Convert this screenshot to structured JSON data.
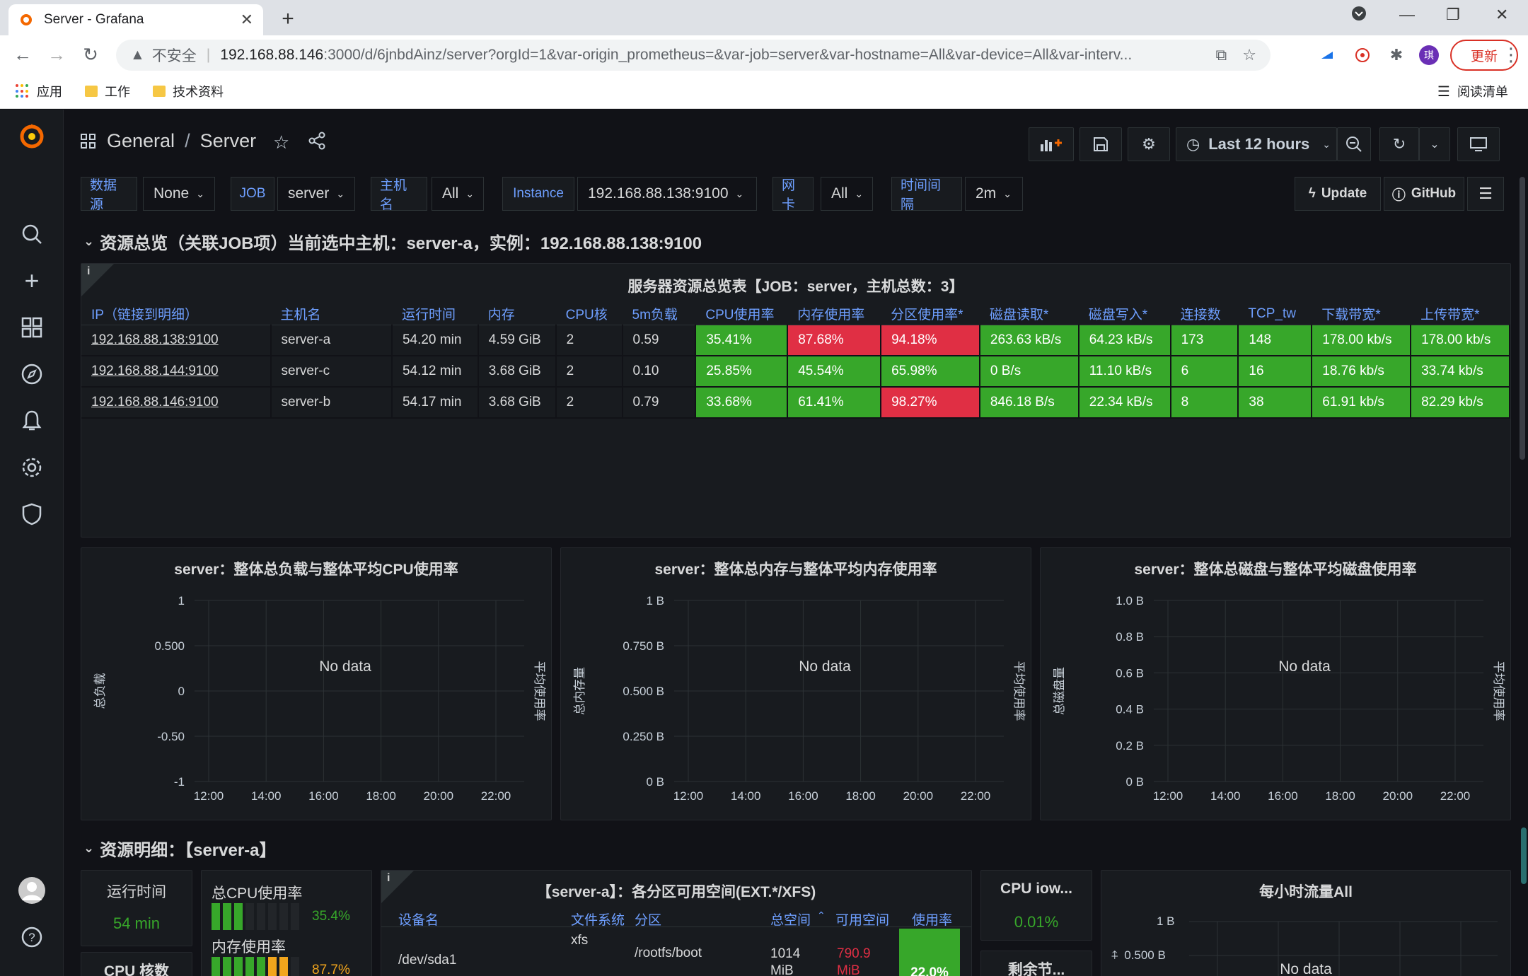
{
  "browser": {
    "tab_title": "Server - Grafana",
    "insecure_label": "不安全",
    "url_host": "192.168.88.146",
    "url_rest": ":3000/d/6jnbdAinz/server?orgId=1&var-origin_prometheus=&var-job=server&var-hostname=All&var-device=All&var-interv...",
    "update_label": "更新",
    "profile_initial": "琪",
    "bookmarks": [
      "应用",
      "工作",
      "技术资料"
    ],
    "reading_list": "阅读清单"
  },
  "dashboard": {
    "folder": "General",
    "title": "Server",
    "time_range": "Last 12 hours"
  },
  "variables": [
    {
      "label": "数据源",
      "value": "None"
    },
    {
      "label": "JOB",
      "value": "server"
    },
    {
      "label": "主机名",
      "value": "All"
    },
    {
      "label": "Instance",
      "value": "192.168.88.138:9100"
    },
    {
      "label": "网卡",
      "value": "All"
    },
    {
      "label": "时间间隔",
      "value": "2m"
    }
  ],
  "links": {
    "update": "Update",
    "github": "GitHub"
  },
  "row1_title": "资源总览（关联JOB项）当前选中主机：server-a，实例：192.168.88.138:9100",
  "overview_table": {
    "title": "服务器资源总览表【JOB：server，主机总数：3】",
    "info_icon": "i",
    "columns": [
      "IP（链接到明细）",
      "主机名",
      "运行时间",
      "内存",
      "CPU核",
      "5m负载",
      "CPU使用率",
      "内存使用率",
      "分区使用率*",
      "磁盘读取*",
      "磁盘写入*",
      "连接数",
      "TCP_tw",
      "下载带宽*",
      "上传带宽*"
    ],
    "rows": [
      {
        "cells": [
          "192.168.88.138:9100",
          "server-a",
          "54.20 min",
          "4.59 GiB",
          "2",
          "0.59",
          "35.41%",
          "87.68%",
          "94.18%",
          "263.63 kB/s",
          "64.23 kB/s",
          "173",
          "148",
          "178.00 kb/s",
          "178.00 kb/s"
        ],
        "status": [
          "",
          "",
          "",
          "",
          "",
          "",
          "g",
          "r",
          "r",
          "g",
          "g",
          "g",
          "g",
          "g",
          "g"
        ]
      },
      {
        "cells": [
          "192.168.88.144:9100",
          "server-c",
          "54.12 min",
          "3.68 GiB",
          "2",
          "0.10",
          "25.85%",
          "45.54%",
          "65.98%",
          "0 B/s",
          "11.10 kB/s",
          "6",
          "16",
          "18.76 kb/s",
          "33.74 kb/s"
        ],
        "status": [
          "",
          "",
          "",
          "",
          "",
          "",
          "g",
          "g",
          "g",
          "g",
          "g",
          "g",
          "g",
          "g",
          "g"
        ]
      },
      {
        "cells": [
          "192.168.88.146:9100",
          "server-b",
          "54.17 min",
          "3.68 GiB",
          "2",
          "0.79",
          "33.68%",
          "61.41%",
          "98.27%",
          "846.18 B/s",
          "22.34 kB/s",
          "8",
          "38",
          "61.91 kb/s",
          "82.29 kb/s"
        ],
        "status": [
          "",
          "",
          "",
          "",
          "",
          "",
          "g",
          "g",
          "r",
          "g",
          "g",
          "g",
          "g",
          "g",
          "g"
        ]
      }
    ]
  },
  "chart_data": [
    {
      "type": "line",
      "title": "server：整体总负载与整体平均CPU使用率",
      "ylabel": "总负载",
      "y2label": "平均使用率",
      "yticks": [
        "1",
        "0.500",
        "0",
        "-0.50",
        "-1"
      ],
      "xticks": [
        "12:00",
        "14:00",
        "16:00",
        "18:00",
        "20:00",
        "22:00"
      ],
      "ylim": [
        -1,
        1
      ],
      "series": [],
      "no_data": "No data"
    },
    {
      "type": "line",
      "title": "server：整体总内存与整体平均内存使用率",
      "ylabel": "总内存量",
      "y2label": "平均使用率",
      "yticks": [
        "1 B",
        "0.750 B",
        "0.500 B",
        "0.250 B",
        "0 B"
      ],
      "xticks": [
        "12:00",
        "14:00",
        "16:00",
        "18:00",
        "20:00",
        "22:00"
      ],
      "ylim": [
        0,
        1
      ],
      "series": [],
      "no_data": "No data"
    },
    {
      "type": "line",
      "title": "server：整体总磁盘与整体平均磁盘使用率",
      "ylabel": "总磁盘量",
      "y2label": "平均使用率",
      "yticks": [
        "1.0 B",
        "0.8 B",
        "0.6 B",
        "0.4 B",
        "0.2 B",
        "0 B"
      ],
      "xticks": [
        "12:00",
        "14:00",
        "16:00",
        "18:00",
        "20:00",
        "22:00"
      ],
      "ylim": [
        0,
        1
      ],
      "series": [],
      "no_data": "No data"
    }
  ],
  "row2_title": "资源明细：【server-a】",
  "stats": {
    "uptime_title": "运行时间",
    "uptime_value": "54 min",
    "cpu_cores_title": "CPU 核数",
    "cpu_usage_title": "总CPU使用率",
    "cpu_usage_value": "35.4%",
    "cpu_usage_fraction": 0.354,
    "mem_usage_title": "内存使用率",
    "mem_usage_value": "87.7%",
    "mem_usage_fraction": 0.877,
    "iowait_title": "CPU iow...",
    "iowait_value": "0.01%",
    "remaining_title": "剩余节..."
  },
  "partition_table": {
    "title": "【server-a】：各分区可用空间(EXT.*/XFS)",
    "info_icon": "i",
    "columns": [
      "设备名",
      "文件系统",
      "分区",
      "总空间",
      "可用空间",
      "使用率"
    ],
    "row": {
      "device": "/dev/sda1",
      "fs": "xfs",
      "mount": "/rootfs/boot",
      "total": "1014 MiB",
      "avail": "790.9 MiB",
      "usage": "22.0%"
    }
  },
  "traffic_panel": {
    "title": "每小时流量All",
    "ytick": "1 B",
    "ytick2": "0.500 B",
    "no_data": "No data"
  },
  "colors": {
    "green": "#37a72a",
    "red": "#e02f44",
    "blue": "#6e9fff",
    "orange": "#f46800"
  }
}
